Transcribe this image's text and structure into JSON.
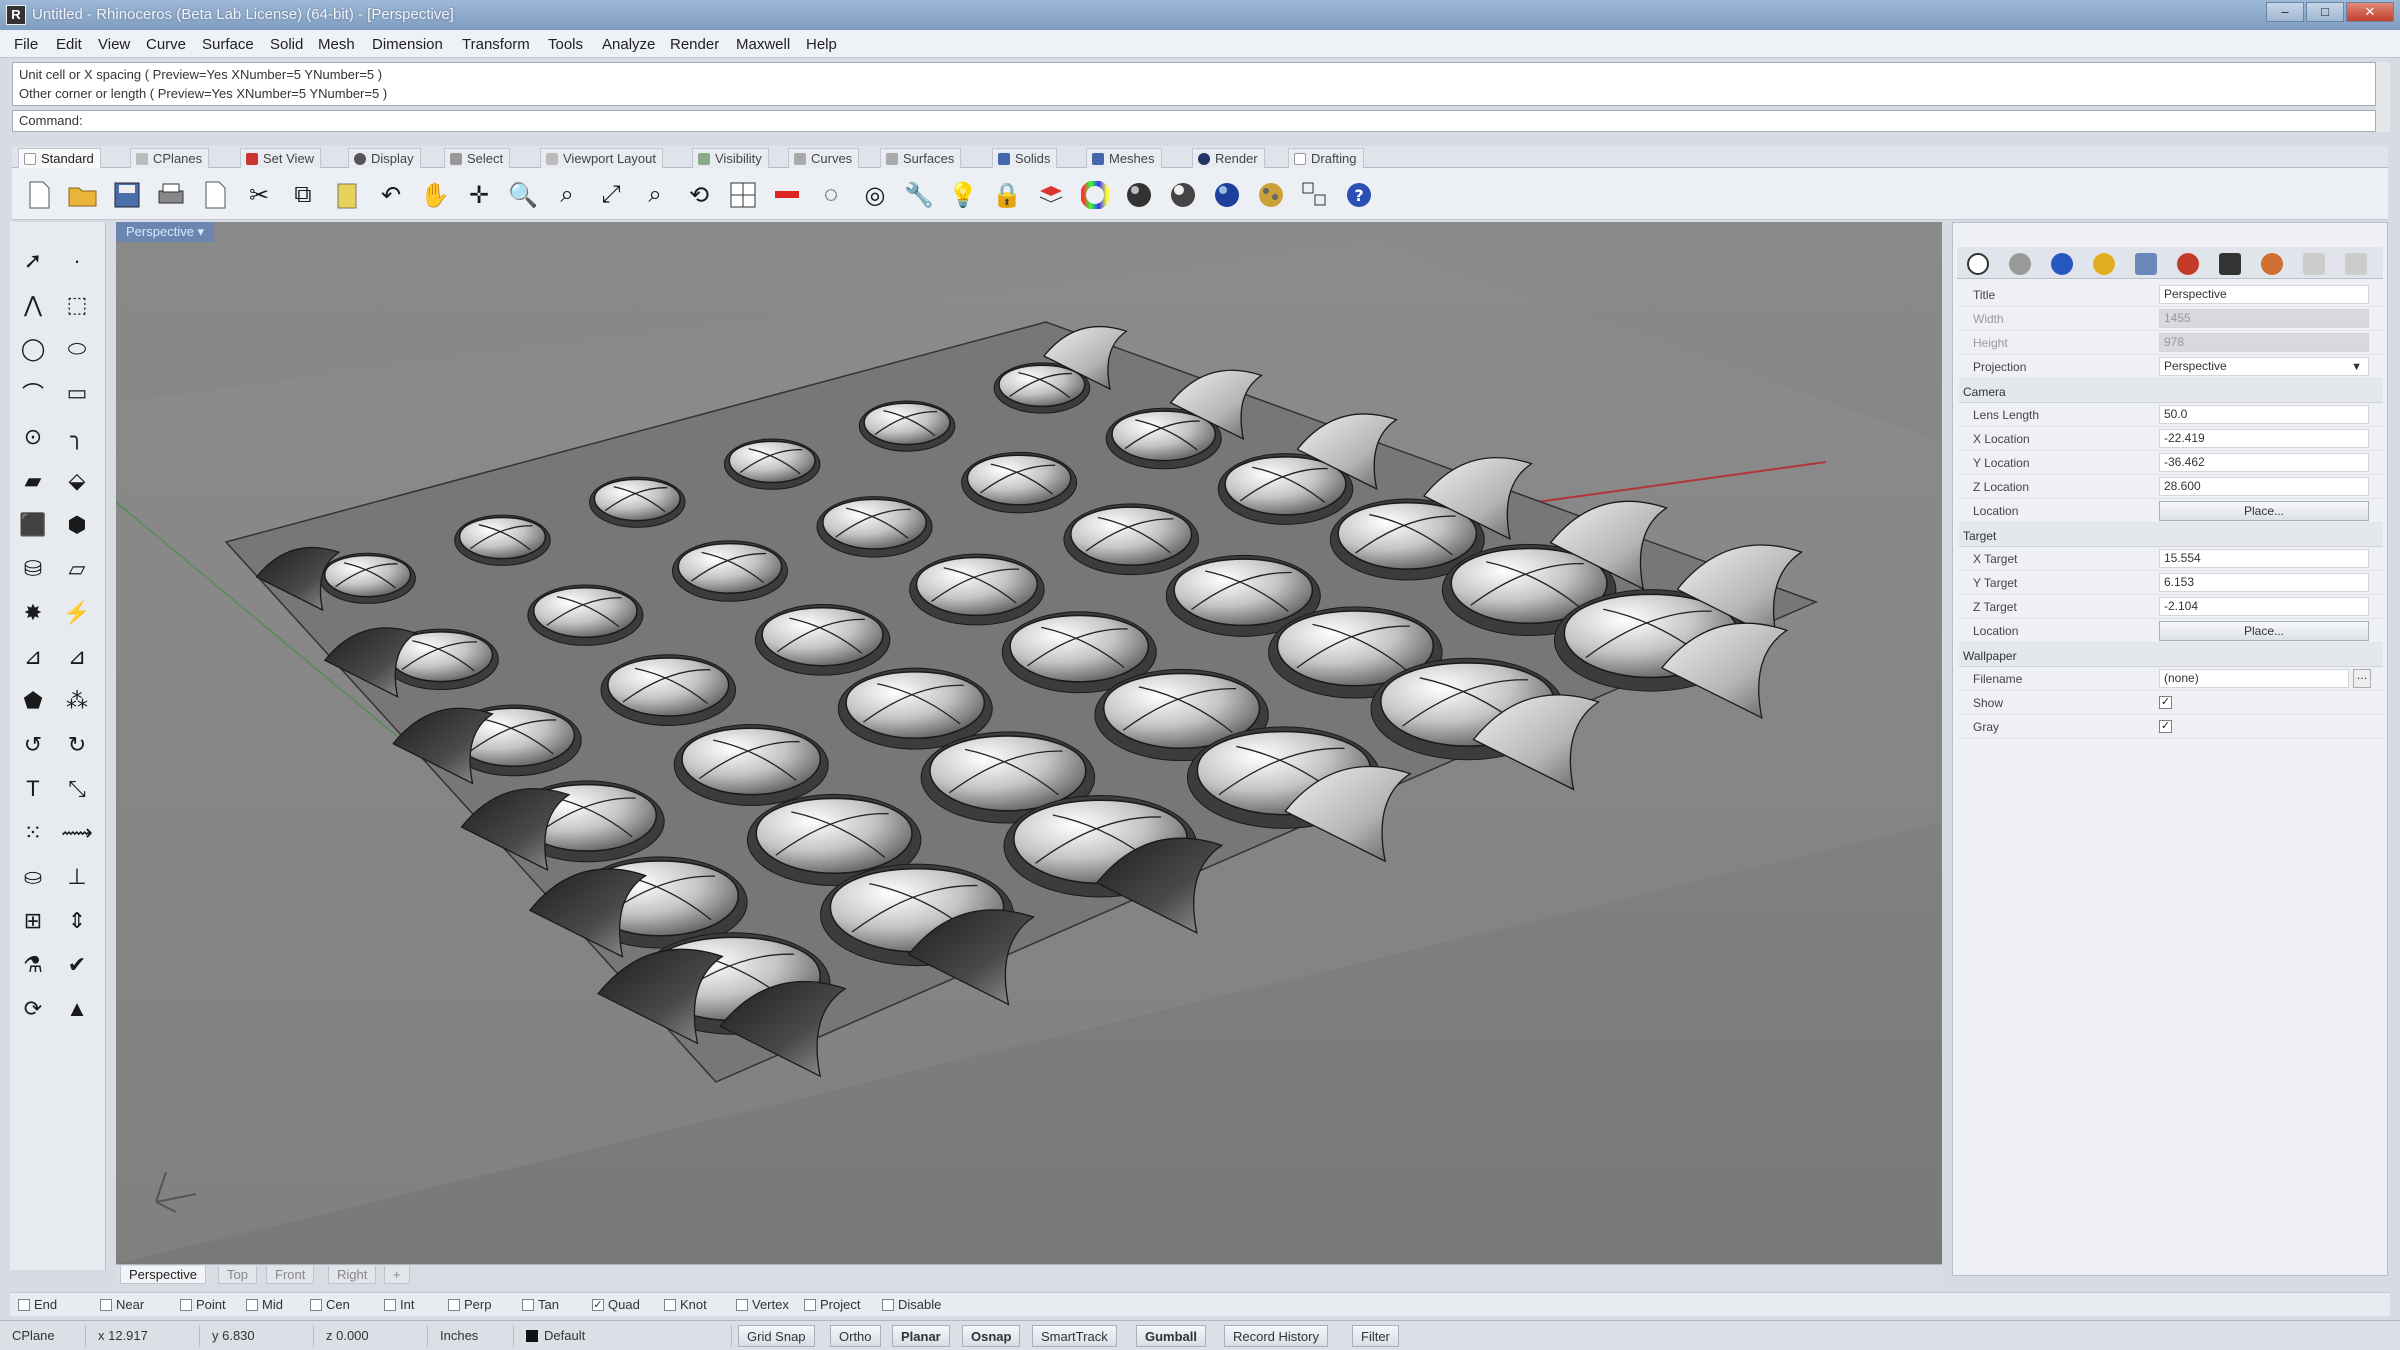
{
  "window": {
    "title": "Untitled - Rhinoceros (Beta Lab License) (64-bit) - [Perspective]",
    "controls": [
      "–",
      "□",
      "✕"
    ]
  },
  "menu": [
    "File",
    "Edit",
    "View",
    "Curve",
    "Surface",
    "Solid",
    "Mesh",
    "Dimension",
    "Transform",
    "Tools",
    "Analyze",
    "Render",
    "Maxwell",
    "Help"
  ],
  "command": {
    "history": [
      "Unit cell or X spacing ( Preview=Yes  XNumber=5  YNumber=5 )",
      "Other corner or length ( Preview=Yes  XNumber=5  YNumber=5 )"
    ],
    "prompt": "Command:"
  },
  "toolbar_tabs": [
    "Standard",
    "CPlanes",
    "Set View",
    "Display",
    "Select",
    "Viewport Layout",
    "Visibility",
    "Curves",
    "Surfaces",
    "Solids",
    "Meshes",
    "Render",
    "Drafting"
  ],
  "viewport": {
    "name": "Perspective",
    "tabs": [
      "Perspective",
      "Top",
      "Front",
      "Right"
    ],
    "add_tab": "+"
  },
  "osnaps": [
    {
      "label": "End",
      "checked": false
    },
    {
      "label": "Near",
      "checked": false
    },
    {
      "label": "Point",
      "checked": false
    },
    {
      "label": "Mid",
      "checked": false
    },
    {
      "label": "Cen",
      "checked": false
    },
    {
      "label": "Int",
      "checked": false
    },
    {
      "label": "Perp",
      "checked": false
    },
    {
      "label": "Tan",
      "checked": false
    },
    {
      "label": "Quad",
      "checked": true
    },
    {
      "label": "Knot",
      "checked": false
    },
    {
      "label": "Vertex",
      "checked": false
    },
    {
      "label": "Project",
      "checked": false
    },
    {
      "label": "Disable",
      "checked": false
    }
  ],
  "status": {
    "cplane": "CPlane",
    "x": "x 12.917",
    "y": "y 6.830",
    "z": "z 0.000",
    "units": "Inches",
    "layer": "Default",
    "buttons": [
      "Grid Snap",
      "Ortho",
      "Planar",
      "Osnap",
      "SmartTrack",
      "Gumball",
      "Record History",
      "Filter"
    ]
  },
  "properties": {
    "rows_top": [
      {
        "label": "Title",
        "value": "Perspective",
        "disabled": false
      },
      {
        "label": "Width",
        "value": "1455",
        "disabled": true
      },
      {
        "label": "Height",
        "value": "978",
        "disabled": true
      },
      {
        "label": "Projection",
        "value": "Perspective",
        "dropdown": true
      }
    ],
    "camera_head": "Camera",
    "camera": [
      {
        "label": "Lens Length",
        "value": "50.0"
      },
      {
        "label": "X Location",
        "value": "-22.419"
      },
      {
        "label": "Y Location",
        "value": "-36.462"
      },
      {
        "label": "Z Location",
        "value": "28.600"
      },
      {
        "label": "Location",
        "button": "Place..."
      }
    ],
    "target_head": "Target",
    "target": [
      {
        "label": "X Target",
        "value": "15.554"
      },
      {
        "label": "Y Target",
        "value": "6.153"
      },
      {
        "label": "Z Target",
        "value": "-2.104"
      },
      {
        "label": "Location",
        "button": "Place..."
      }
    ],
    "wallpaper_head": "Wallpaper",
    "wallpaper": [
      {
        "label": "Filename",
        "value": "(none)"
      },
      {
        "label": "Show",
        "checked": true
      },
      {
        "label": "Gray",
        "checked": true
      }
    ]
  }
}
